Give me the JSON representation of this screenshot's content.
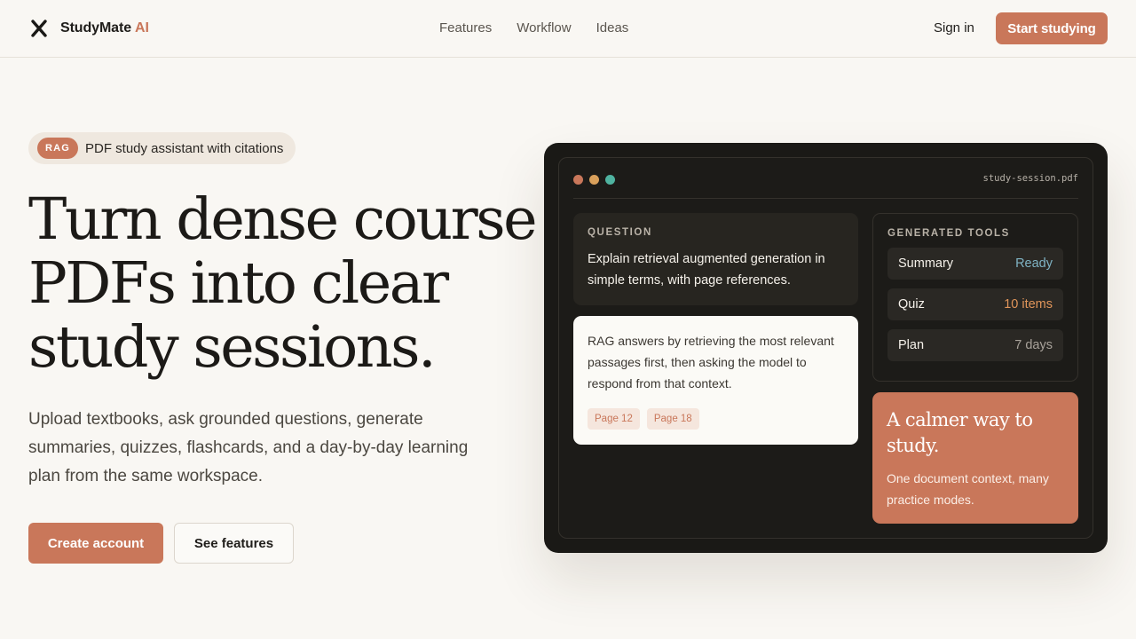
{
  "header": {
    "brand": "StudyMate",
    "brand_suffix": "AI",
    "nav": [
      "Features",
      "Workflow",
      "Ideas"
    ],
    "sign_in": "Sign in",
    "cta": "Start studying"
  },
  "hero": {
    "badge": "RAG",
    "badge_text": "PDF study assistant with citations",
    "title_lines": [
      "Turn dense course",
      "PDFs into clear",
      "study sessions."
    ],
    "subtitle": "Upload textbooks, ask grounded questions, generate summaries, quizzes, flashcards, and a day-by-day learning plan from the same workspace.",
    "primary_button": "Create account",
    "secondary_button": "See features"
  },
  "mock": {
    "filename": "study-session.pdf",
    "dot_colors": [
      "#c9775a",
      "#d9a05b",
      "#4fb3a0"
    ],
    "question_label": "QUESTION",
    "question": "Explain retrieval augmented generation in simple terms, with page references.",
    "answer": "RAG answers by retrieving the most relevant passages first, then asking the model to respond from that context.",
    "citations": [
      "Page 12",
      "Page 18"
    ],
    "tools_label": "GENERATED TOOLS",
    "tools": [
      {
        "label": "Summary",
        "status": "Ready",
        "color": "#7fb3c4"
      },
      {
        "label": "Quiz",
        "status": "10 items",
        "color": "#e0955a"
      },
      {
        "label": "Plan",
        "status": "7 days",
        "color": "#a8a29a"
      }
    ],
    "promo_title": "A calmer way to study.",
    "promo_text": "One document context, many practice modes."
  },
  "colors": {
    "accent": "#c9775a",
    "background": "#f9f7f3",
    "dark": "#1a1916"
  }
}
